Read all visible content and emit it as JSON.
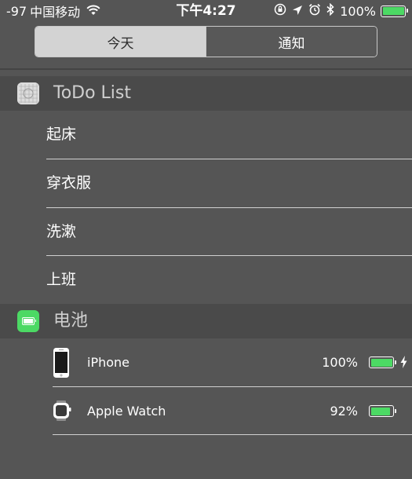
{
  "status_bar": {
    "signal": "-97",
    "carrier": "中国移动",
    "time": "下午4:27",
    "battery_percent_text": "100%",
    "battery_level": 1.0,
    "icons": [
      "wifi-icon",
      "orientation-lock-icon",
      "location-arrow-icon",
      "alarm-icon",
      "bluetooth-icon",
      "battery-icon"
    ]
  },
  "segment": {
    "tabs": [
      {
        "label": "今天",
        "active": true
      },
      {
        "label": "通知",
        "active": false
      }
    ]
  },
  "todo_widget": {
    "title": "ToDo List",
    "icon": "todo-list-icon",
    "items": [
      {
        "label": "起床"
      },
      {
        "label": "穿衣服"
      },
      {
        "label": "洗漱"
      },
      {
        "label": "上班"
      }
    ]
  },
  "battery_widget": {
    "title": "电池",
    "icon": "battery-app-icon",
    "devices": [
      {
        "name": "iPhone",
        "percent_text": "100%",
        "level": 1.0,
        "charging": true,
        "icon": "iphone-icon"
      },
      {
        "name": "Apple Watch",
        "percent_text": "92%",
        "level": 0.92,
        "charging": false,
        "icon": "apple-watch-icon"
      }
    ]
  },
  "colors": {
    "background": "#555555",
    "header_background": "#4a4a4a",
    "battery_green": "#4cd964",
    "segment_active": "#d3d3d3"
  }
}
